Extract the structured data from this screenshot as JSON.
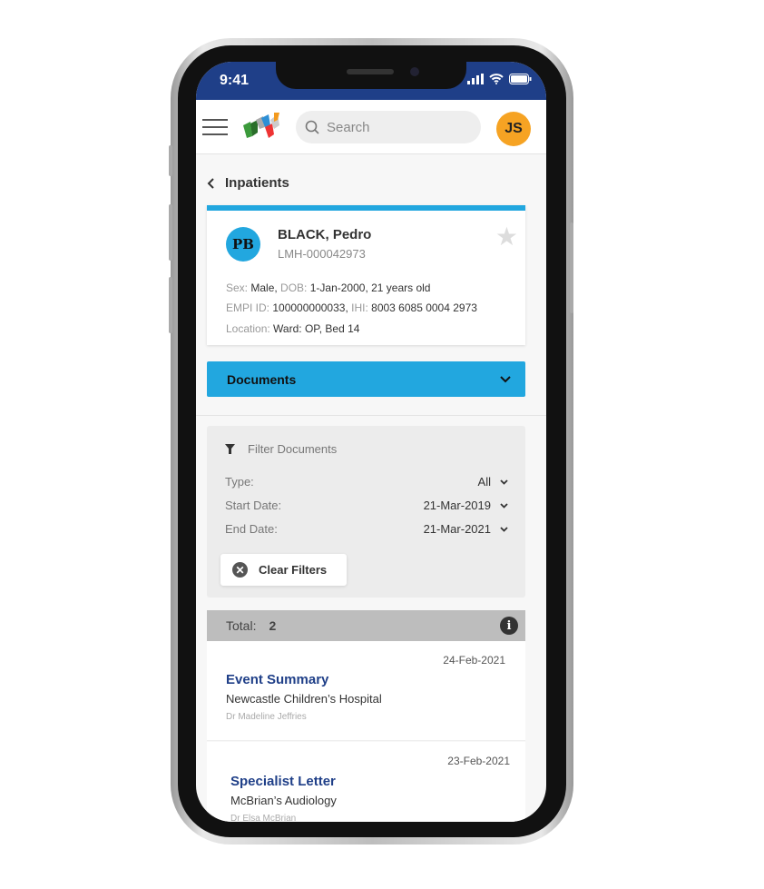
{
  "status": {
    "time": "9:41"
  },
  "header": {
    "search_placeholder": "Search",
    "user_initials": "JS"
  },
  "nav": {
    "back_label": "Inpatients"
  },
  "patient": {
    "initials": "PB",
    "name": "BLACK, Pedro",
    "mrn": "LMH-000042973",
    "sex_label": "Sex:",
    "sex": "Male,",
    "dob_label": "DOB:",
    "dob": "1-Jan-2000, 21 years old",
    "empi_label": "EMPI ID:",
    "empi": "100000000033,",
    "ihi_label": "IHI:",
    "ihi": "8003 6085 0004 2973",
    "location_label": "Location:",
    "location": "Ward: OP, Bed 14"
  },
  "section": {
    "label": "Documents"
  },
  "filter": {
    "title": "Filter Documents",
    "rows": [
      {
        "label": "Type:",
        "value": "All"
      },
      {
        "label": "Start Date:",
        "value": "21-Mar-2019"
      },
      {
        "label": "End Date:",
        "value": "21-Mar-2021"
      }
    ],
    "clear_label": "Clear Filters"
  },
  "total": {
    "label": "Total:",
    "count": "2"
  },
  "documents": [
    {
      "date": "24-Feb-2021",
      "title": "Event Summary",
      "org": "Newcastle Children’s Hospital",
      "author": "Dr Madeline Jeffries"
    },
    {
      "date": "23-Feb-2021",
      "title": "Specialist Letter",
      "org": "McBrian’s Audiology",
      "author": "Dr Elsa McBrian"
    }
  ],
  "colors": {
    "status_bar": "#1f3f88",
    "accent": "#22a7df",
    "avatar": "#f6a323",
    "doc_title": "#1f3f88"
  }
}
